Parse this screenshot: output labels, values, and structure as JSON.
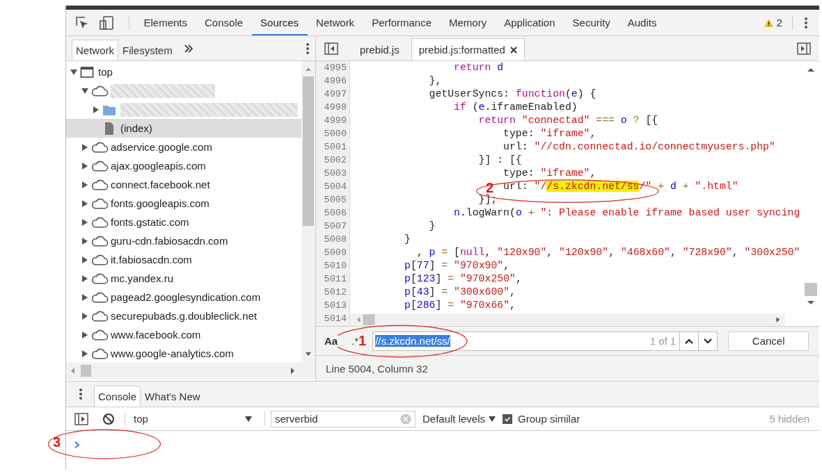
{
  "main_tabs": [
    {
      "label": "Elements",
      "selected": false
    },
    {
      "label": "Console",
      "selected": false
    },
    {
      "label": "Sources",
      "selected": true
    },
    {
      "label": "Network",
      "selected": false
    },
    {
      "label": "Performance",
      "selected": false
    },
    {
      "label": "Memory",
      "selected": false
    },
    {
      "label": "Application",
      "selected": false
    },
    {
      "label": "Security",
      "selected": false
    },
    {
      "label": "Audits",
      "selected": false
    }
  ],
  "warnings": {
    "count": "2"
  },
  "navigator": {
    "tabs": [
      {
        "label": "Network",
        "selected": true
      },
      {
        "label": "Filesystem",
        "selected": false
      }
    ]
  },
  "tree": [
    {
      "label": "top",
      "kind": "frame",
      "expanded": true,
      "selected": false,
      "children": [
        {
          "kind": "cloud",
          "redacted": true,
          "expanded": true,
          "selected": false,
          "children": [
            {
              "kind": "folder",
              "redacted": true,
              "expanded": false,
              "selected": false
            },
            {
              "kind": "file",
              "label": "(index)",
              "selected": true
            }
          ]
        },
        {
          "kind": "cloud",
          "label": "adservice.google.com",
          "expanded": false,
          "selected": false
        },
        {
          "kind": "cloud",
          "label": "ajax.googleapis.com",
          "expanded": false,
          "selected": false
        },
        {
          "kind": "cloud",
          "label": "connect.facebook.net",
          "expanded": false,
          "selected": false
        },
        {
          "kind": "cloud",
          "label": "fonts.googleapis.com",
          "expanded": false,
          "selected": false
        },
        {
          "kind": "cloud",
          "label": "fonts.gstatic.com",
          "expanded": false,
          "selected": false
        },
        {
          "kind": "cloud",
          "label": "guru-cdn.fabiosacdn.com",
          "expanded": false,
          "selected": false
        },
        {
          "kind": "cloud",
          "label": "it.fabiosacdn.com",
          "expanded": false,
          "selected": false
        },
        {
          "kind": "cloud",
          "label": "mc.yandex.ru",
          "expanded": false,
          "selected": false
        },
        {
          "kind": "cloud",
          "label": "pagead2.googlesyndication.com",
          "expanded": false,
          "selected": false
        },
        {
          "kind": "cloud",
          "label": "securepubads.g.doubleclick.net",
          "expanded": false,
          "selected": false
        },
        {
          "kind": "cloud",
          "label": "www.facebook.com",
          "expanded": false,
          "selected": false
        },
        {
          "kind": "cloud",
          "label": "www.google-analytics.com",
          "expanded": false,
          "selected": false
        }
      ]
    }
  ],
  "editor": {
    "tabs": [
      {
        "label": "prebid.js",
        "selected": false,
        "closable": false
      },
      {
        "label": "prebid.js:formatted",
        "selected": true,
        "closable": true
      }
    ],
    "lines": [
      {
        "number": "4995",
        "tokens": [
          {
            "kind": "kw",
            "text": "                return "
          },
          {
            "kind": "var",
            "text": "d"
          }
        ]
      },
      {
        "number": "4996",
        "tokens": [
          {
            "kind": "plain",
            "text": "            },"
          }
        ]
      },
      {
        "number": "4997",
        "tokens": [
          {
            "kind": "plain",
            "text": "            getUserSyncs: "
          },
          {
            "kind": "kw",
            "text": "function"
          },
          {
            "kind": "plain",
            "text": "("
          },
          {
            "kind": "var",
            "text": "e"
          },
          {
            "kind": "plain",
            "text": ") {"
          }
        ]
      },
      {
        "number": "4998",
        "tokens": [
          {
            "kind": "kw",
            "text": "                if"
          },
          {
            "kind": "plain",
            "text": " ("
          },
          {
            "kind": "var",
            "text": "e"
          },
          {
            "kind": "plain",
            "text": ".iframeEnabled)"
          }
        ]
      },
      {
        "number": "4999",
        "tokens": [
          {
            "kind": "kw",
            "text": "                    return "
          },
          {
            "kind": "str",
            "text": "\"connectad\" "
          },
          {
            "kind": "op",
            "text": "=== "
          },
          {
            "kind": "var",
            "text": "o "
          },
          {
            "kind": "op",
            "text": "?"
          },
          {
            "kind": "plain",
            "text": " [{"
          }
        ]
      },
      {
        "number": "5000",
        "tokens": [
          {
            "kind": "plain",
            "text": "                        type: "
          },
          {
            "kind": "str",
            "text": "\"iframe\""
          },
          {
            "kind": "plain",
            "text": ","
          }
        ]
      },
      {
        "number": "5001",
        "tokens": [
          {
            "kind": "plain",
            "text": "                        url: "
          },
          {
            "kind": "str",
            "text": "\"//cdn.connectad.io/connectmyusers.php\""
          }
        ]
      },
      {
        "number": "5002",
        "tokens": [
          {
            "kind": "plain",
            "text": "                    }] : [{"
          }
        ]
      },
      {
        "number": "5003",
        "tokens": [
          {
            "kind": "plain",
            "text": "                        type: "
          },
          {
            "kind": "str",
            "text": "\"iframe\""
          },
          {
            "kind": "plain",
            "text": ","
          }
        ]
      },
      {
        "number": "5004",
        "tokens": [
          {
            "kind": "plain",
            "text": "                        url: "
          },
          {
            "kind": "str",
            "text": "\"/"
          },
          {
            "kind": "match",
            "text": "/s.zkcdn.net/ss"
          },
          {
            "kind": "str",
            "text": "/\" "
          },
          {
            "kind": "op",
            "text": "+ "
          },
          {
            "kind": "var",
            "text": "d "
          },
          {
            "kind": "op",
            "text": "+ "
          },
          {
            "kind": "str",
            "text": "\".html\""
          }
        ]
      },
      {
        "number": "5005",
        "tokens": [
          {
            "kind": "plain",
            "text": "                    }];"
          }
        ]
      },
      {
        "number": "5006",
        "tokens": [
          {
            "kind": "var",
            "text": "                n"
          },
          {
            "kind": "plain",
            "text": ".logWarn("
          },
          {
            "kind": "var",
            "text": "o "
          },
          {
            "kind": "op",
            "text": "+ "
          },
          {
            "kind": "str",
            "text": "\": Please enable iframe based user syncing"
          }
        ]
      },
      {
        "number": "5007",
        "tokens": [
          {
            "kind": "plain",
            "text": "            }"
          }
        ]
      },
      {
        "number": "5008",
        "tokens": [
          {
            "kind": "plain",
            "text": "        }"
          }
        ]
      },
      {
        "number": "5009",
        "tokens": [
          {
            "kind": "plain",
            "text": "          , "
          },
          {
            "kind": "var",
            "text": "p "
          },
          {
            "kind": "op",
            "text": "="
          },
          {
            "kind": "plain",
            "text": " ["
          },
          {
            "kind": "kw",
            "text": "null"
          },
          {
            "kind": "plain",
            "text": ", "
          },
          {
            "kind": "str",
            "text": "\"120x90\""
          },
          {
            "kind": "plain",
            "text": ", "
          },
          {
            "kind": "str",
            "text": "\"120x90\""
          },
          {
            "kind": "plain",
            "text": ", "
          },
          {
            "kind": "str",
            "text": "\"468x60\""
          },
          {
            "kind": "plain",
            "text": ", "
          },
          {
            "kind": "str",
            "text": "\"728x90\""
          },
          {
            "kind": "plain",
            "text": ", "
          },
          {
            "kind": "str",
            "text": "\"300x250\""
          }
        ]
      },
      {
        "number": "5010",
        "tokens": [
          {
            "kind": "var",
            "text": "        p"
          },
          {
            "kind": "plain",
            "text": "["
          },
          {
            "kind": "var",
            "text": "77"
          },
          {
            "kind": "plain",
            "text": "] "
          },
          {
            "kind": "op",
            "text": "= "
          },
          {
            "kind": "str",
            "text": "\"970x90\""
          },
          {
            "kind": "plain",
            "text": ","
          }
        ]
      },
      {
        "number": "5011",
        "tokens": [
          {
            "kind": "var",
            "text": "        p"
          },
          {
            "kind": "plain",
            "text": "["
          },
          {
            "kind": "var",
            "text": "123"
          },
          {
            "kind": "plain",
            "text": "] "
          },
          {
            "kind": "op",
            "text": "= "
          },
          {
            "kind": "str",
            "text": "\"970x250\""
          },
          {
            "kind": "plain",
            "text": ","
          }
        ]
      },
      {
        "number": "5012",
        "tokens": [
          {
            "kind": "var",
            "text": "        p"
          },
          {
            "kind": "plain",
            "text": "["
          },
          {
            "kind": "var",
            "text": "43"
          },
          {
            "kind": "plain",
            "text": "] "
          },
          {
            "kind": "op",
            "text": "= "
          },
          {
            "kind": "str",
            "text": "\"300x600\""
          },
          {
            "kind": "plain",
            "text": ","
          }
        ]
      },
      {
        "number": "5013",
        "tokens": [
          {
            "kind": "var",
            "text": "        p"
          },
          {
            "kind": "plain",
            "text": "["
          },
          {
            "kind": "var",
            "text": "286"
          },
          {
            "kind": "plain",
            "text": "] "
          },
          {
            "kind": "op",
            "text": "= "
          },
          {
            "kind": "str",
            "text": "\"970x66\""
          },
          {
            "kind": "plain",
            "text": ","
          }
        ]
      },
      {
        "number": "5014"
      }
    ]
  },
  "search": {
    "case_label": "Aa",
    "regex_label": ".*",
    "value": "//s.zkcdn.net/ss/",
    "value_selected": true,
    "count": "1 of 1",
    "cancel": "Cancel"
  },
  "status": "Line 5004, Column 32",
  "drawer": {
    "tabs": [
      {
        "label": "Console",
        "selected": true
      },
      {
        "label": "What's New",
        "selected": false
      }
    ],
    "context": "top",
    "filter": "serverbid",
    "levels": "Default levels",
    "group_similar": {
      "label": "Group similar",
      "checked": true
    },
    "hidden": "5 hidden"
  },
  "annotations": [
    {
      "number": "1"
    },
    {
      "number": "2"
    },
    {
      "number": "3"
    }
  ]
}
